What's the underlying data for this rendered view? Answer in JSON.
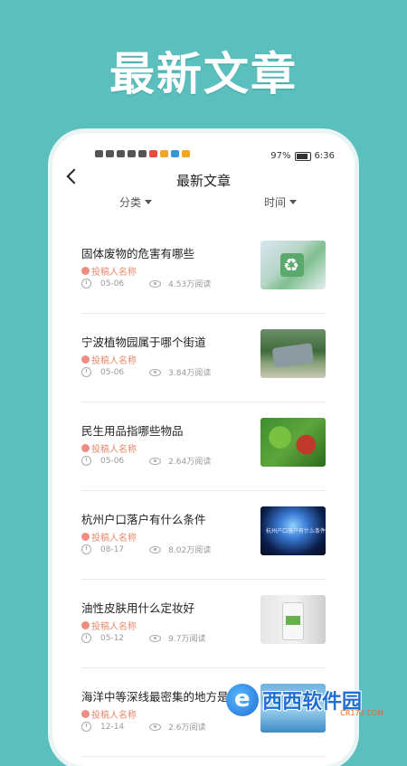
{
  "headline": "最新文章",
  "status_bar": {
    "battery": "97%",
    "time": "6:36"
  },
  "header": {
    "title": "最新文章"
  },
  "filters": [
    {
      "label": "分类"
    },
    {
      "label": "时间"
    }
  ],
  "articles": [
    {
      "title": "固体废物的危害有哪些",
      "author": "投稿人名称",
      "date": "05-06",
      "views": "4.53万阅读"
    },
    {
      "title": "宁波植物园属于哪个街道",
      "author": "投稿人名称",
      "date": "05-06",
      "views": "3.84万阅读"
    },
    {
      "title": "民生用品指哪些物品",
      "author": "投稿人名称",
      "date": "05-06",
      "views": "2.64万阅读"
    },
    {
      "title": "杭州户口落户有什么条件",
      "author": "投稿人名称",
      "date": "08-17",
      "views": "8.02万阅读",
      "thumb_text": "杭州户口落户有什么条件"
    },
    {
      "title": "油性皮肤用什么定妆好",
      "author": "投稿人名称",
      "date": "05-12",
      "views": "9.7万阅读"
    },
    {
      "title": "海洋中等深线最密集的地方是",
      "author": "投稿人名称",
      "date": "12-14",
      "views": "2.6万阅读"
    }
  ],
  "watermark": {
    "text": "西西软件园",
    "sub": "CR173.COM"
  },
  "colors": {
    "background": "#5bbfbe",
    "author": "#e8896b",
    "watermark": "#1f6fd1"
  }
}
